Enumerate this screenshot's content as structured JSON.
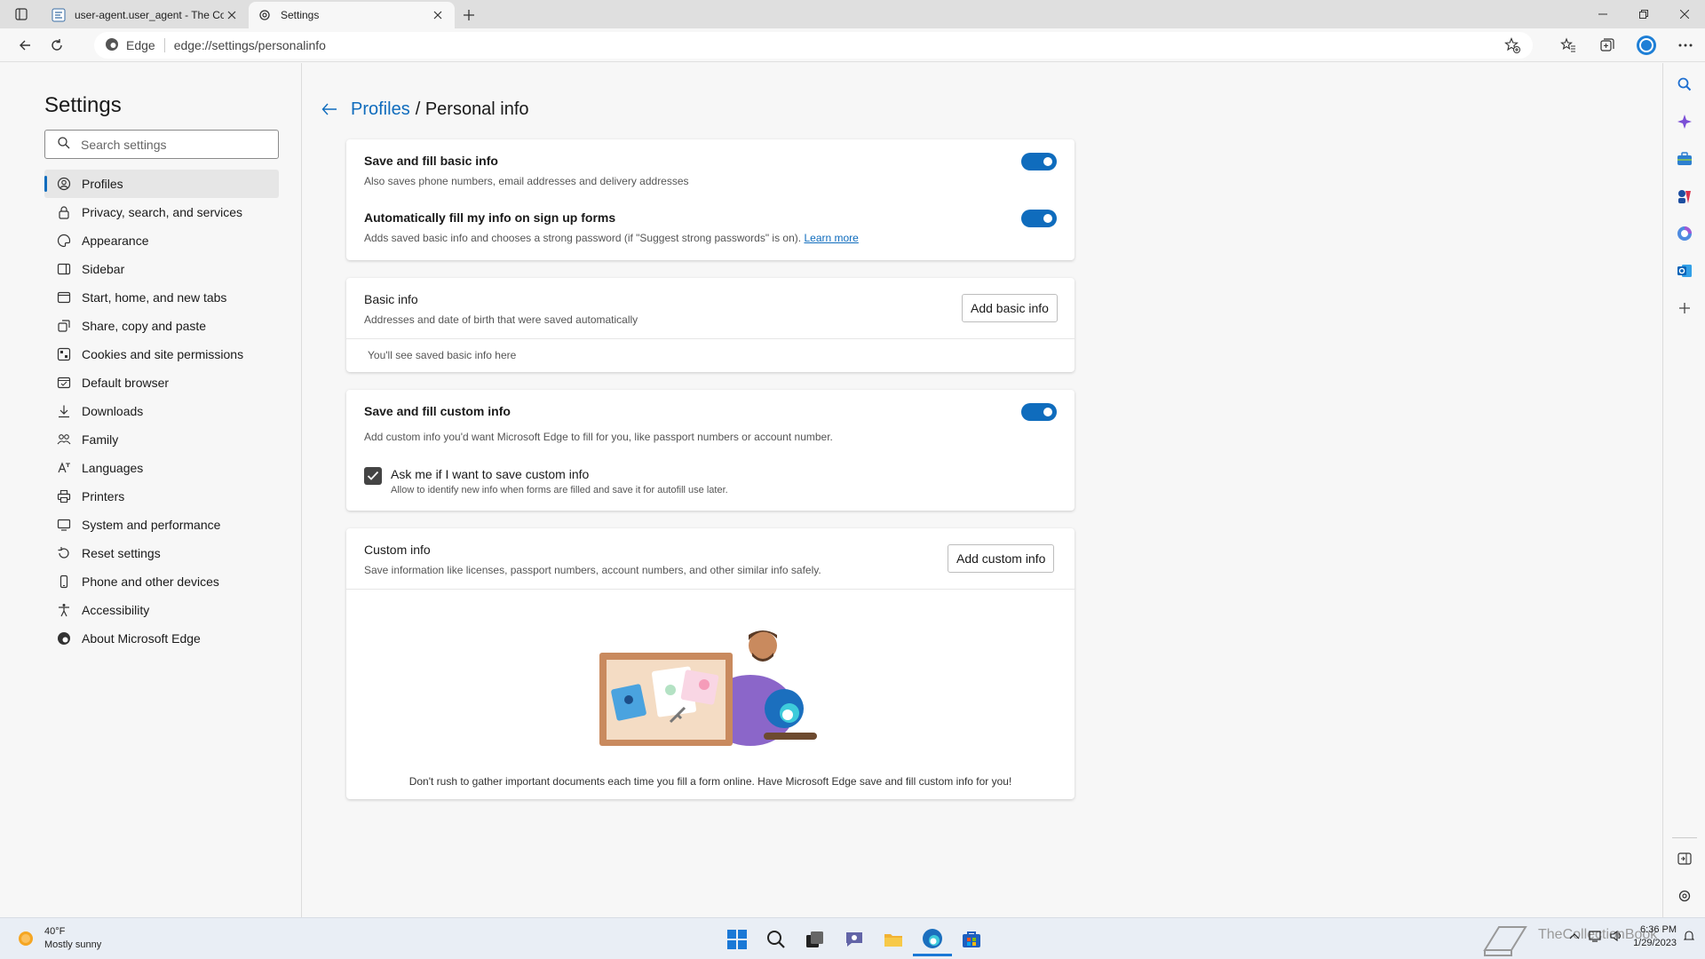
{
  "tabs": [
    {
      "title": "user-agent.user_agent - The Coll",
      "active": false
    },
    {
      "title": "Settings",
      "active": true
    }
  ],
  "address": {
    "site_label": "Edge",
    "url": "edge://settings/personalinfo"
  },
  "sidebar": {
    "title": "Settings",
    "search_placeholder": "Search settings",
    "items": [
      {
        "label": "Profiles",
        "icon": "profile-icon",
        "selected": true
      },
      {
        "label": "Privacy, search, and services",
        "icon": "lock-icon"
      },
      {
        "label": "Appearance",
        "icon": "appearance-icon"
      },
      {
        "label": "Sidebar",
        "icon": "sidebar-icon"
      },
      {
        "label": "Start, home, and new tabs",
        "icon": "home-icon"
      },
      {
        "label": "Share, copy and paste",
        "icon": "share-icon"
      },
      {
        "label": "Cookies and site permissions",
        "icon": "cookie-icon"
      },
      {
        "label": "Default browser",
        "icon": "browser-icon"
      },
      {
        "label": "Downloads",
        "icon": "download-icon"
      },
      {
        "label": "Family",
        "icon": "family-icon"
      },
      {
        "label": "Languages",
        "icon": "language-icon"
      },
      {
        "label": "Printers",
        "icon": "printer-icon"
      },
      {
        "label": "System and performance",
        "icon": "system-icon"
      },
      {
        "label": "Reset settings",
        "icon": "reset-icon"
      },
      {
        "label": "Phone and other devices",
        "icon": "phone-icon"
      },
      {
        "label": "Accessibility",
        "icon": "accessibility-icon"
      },
      {
        "label": "About Microsoft Edge",
        "icon": "edge-icon"
      }
    ]
  },
  "breadcrumb": {
    "parent": "Profiles",
    "current": "/ Personal info"
  },
  "card1": {
    "row1": {
      "title": "Save and fill basic info",
      "sub": "Also saves phone numbers, email addresses and delivery addresses",
      "on": true
    },
    "row2": {
      "title": "Automatically fill my info on sign up forms",
      "sub": "Adds saved basic info and chooses a strong password (if \"Suggest strong passwords\" is on).",
      "link": "Learn more",
      "on": true
    }
  },
  "card2": {
    "title": "Basic info",
    "sub": "Addresses and date of birth that were saved automatically",
    "button": "Add basic info",
    "empty": "You'll see saved basic info here"
  },
  "card3": {
    "title": "Save and fill custom info",
    "sub": "Add custom info you'd want Microsoft Edge to fill for you, like passport numbers or account number.",
    "on": true,
    "checkbox": {
      "label": "Ask me if I want to save custom info",
      "sub": "Allow to identify new info when forms are filled and save it for autofill use later.",
      "checked": true
    }
  },
  "card4": {
    "title": "Custom info",
    "sub": "Save information like licenses, passport numbers, account numbers, and other similar info safely.",
    "button": "Add custom info",
    "caption": "Don't rush to gather important documents each time you fill a form online. Have Microsoft Edge save and fill custom info for you!"
  },
  "taskbar": {
    "temp": "40°F",
    "weather": "Mostly sunny",
    "time": "6:36 PM",
    "date": "1/29/2023",
    "watermark": "TheCollectionBook"
  },
  "colors": {
    "accent": "#0f6cbd"
  }
}
